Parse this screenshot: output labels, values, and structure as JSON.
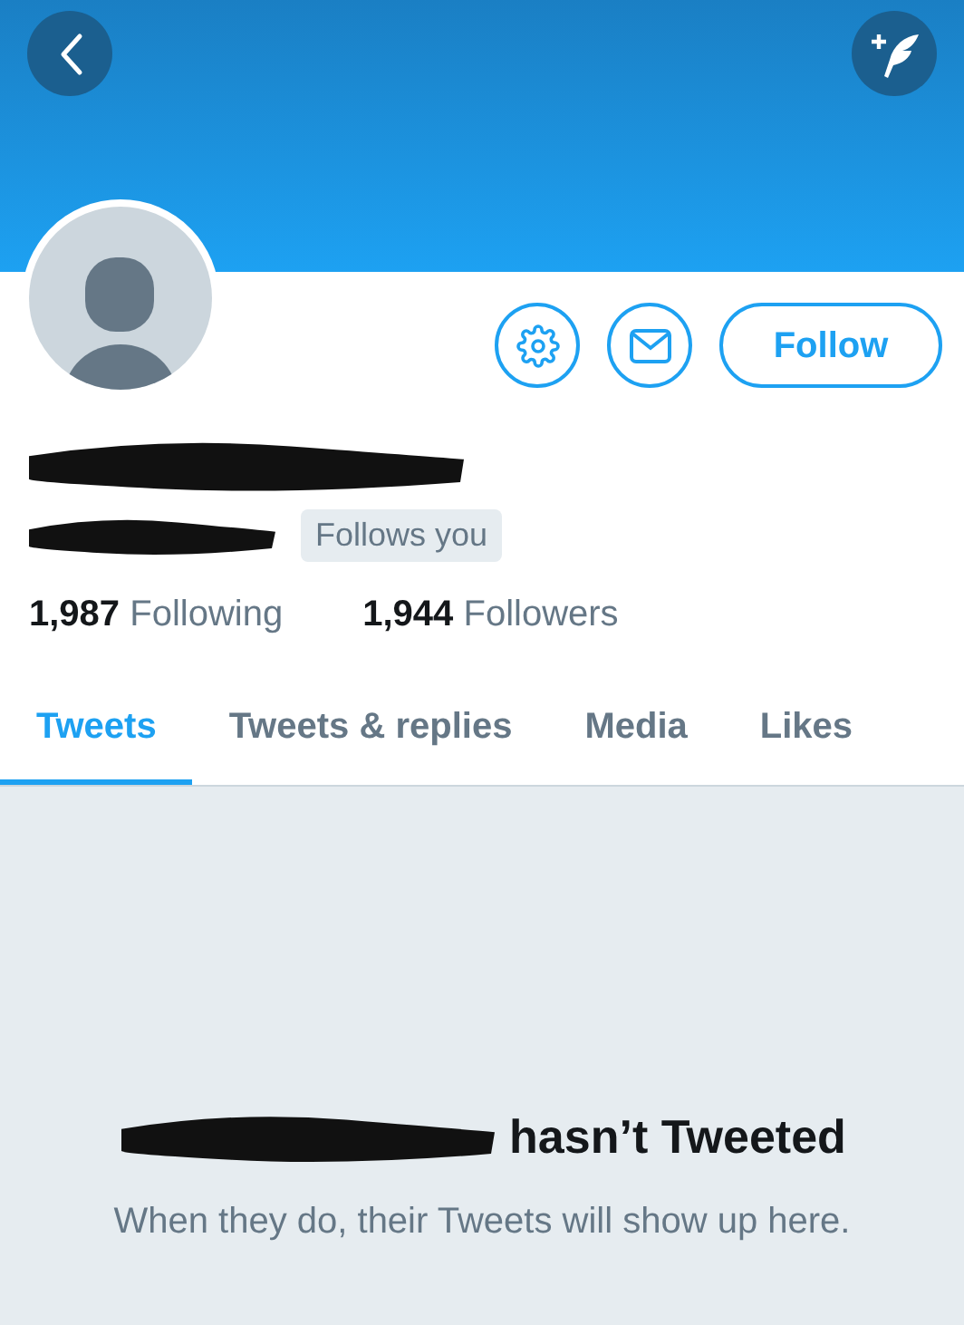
{
  "profile": {
    "name_redacted": true,
    "handle_redacted": true,
    "follows_you": "Follows you",
    "actions": [
      {
        "kind": "settings"
      },
      {
        "kind": "message"
      },
      {
        "kind": "follow",
        "label": "Follow"
      }
    ],
    "stats": [
      {
        "count": "1,987",
        "label": "Following"
      },
      {
        "count": "1,944",
        "label": "Followers"
      }
    ]
  },
  "tabs": [
    {
      "label": "Tweets",
      "selected": true
    },
    {
      "label": "Tweets & replies",
      "selected": false
    },
    {
      "label": "Media",
      "selected": false
    },
    {
      "label": "Likes",
      "selected": false
    }
  ],
  "empty_state": {
    "handle_redacted": true,
    "title": "hasn’t Tweeted",
    "message": "When they do, their Tweets will show up here."
  }
}
